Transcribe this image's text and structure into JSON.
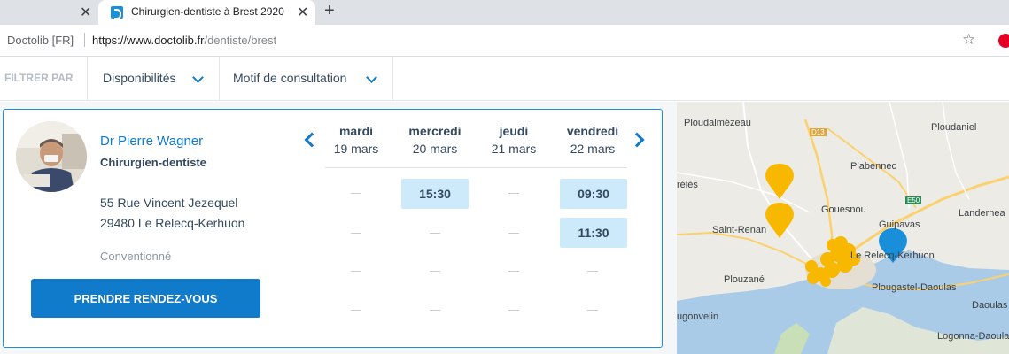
{
  "browser": {
    "active_tab_title": "Chirurgien-dentiste à Brest 2920",
    "site_label": "Doctolib [FR]",
    "url_host": "https://www.doctolib.fr",
    "url_path": "/dentiste/brest"
  },
  "filters": {
    "label": "FILTRER PAR",
    "availability": "Disponibilités",
    "reason": "Motif de consultation"
  },
  "doctor": {
    "name": "Dr Pierre Wagner",
    "specialty": "Chirurgien-dentiste",
    "address_line1": "55 Rue Vincent Jezequel",
    "address_line2": "29480 Le Relecq-Kerhuon",
    "convention": "Conventionné",
    "book_label": "PRENDRE RENDEZ-VOUS"
  },
  "calendar": {
    "days": [
      {
        "name": "mardi",
        "date": "19 mars",
        "slots": []
      },
      {
        "name": "mercredi",
        "date": "20 mars",
        "slots": [
          "15:30"
        ]
      },
      {
        "name": "jeudi",
        "date": "21 mars",
        "slots": []
      },
      {
        "name": "vendredi",
        "date": "22 mars",
        "slots": [
          "09:30",
          "11:30"
        ]
      }
    ]
  },
  "map": {
    "labels": [
      "Ploudalmézeau",
      "Ploudaniel",
      "Plabennec",
      "rélès",
      "Gouesnou",
      "Guipavas",
      "Landernea",
      "Saint-Renan",
      "Le Relecq-Kerhuon",
      "Plouzané",
      "Plougastel-Daoulas",
      "Daoulas",
      "ugonvelin",
      "Logonna-Daoulas"
    ],
    "road_tags": [
      "D13",
      "E50"
    ],
    "colors": {
      "cluster_pin": "#f9b800",
      "selected_pin": "#1a8fd9",
      "water": "#a9cbe8",
      "land": "#ecebe5",
      "road": "#fbd16e"
    }
  }
}
